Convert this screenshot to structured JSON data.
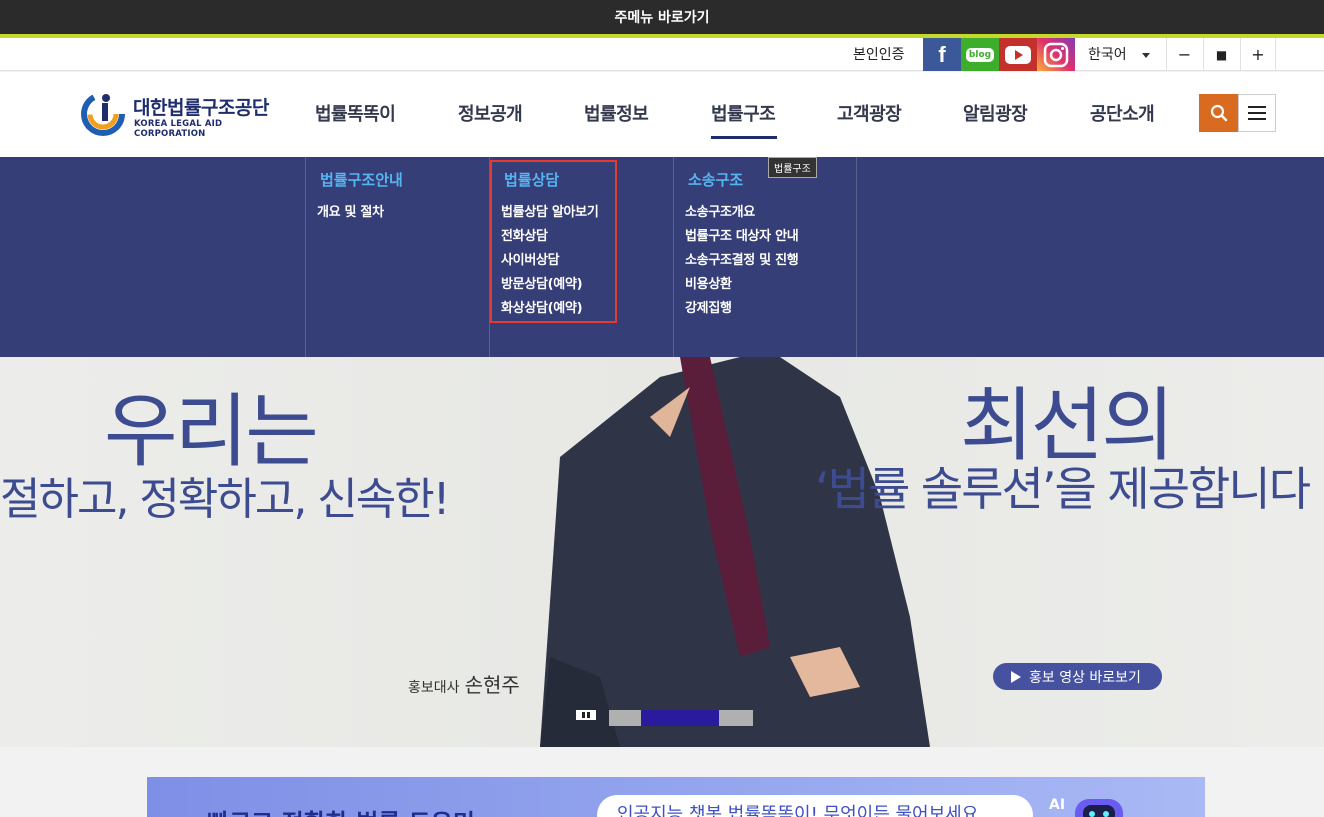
{
  "skip_link": "주메뉴 바로가기",
  "util": {
    "auth": "본인인증",
    "sns": {
      "facebook": "f",
      "blog": "blog"
    },
    "language": "한국어",
    "zoom_out": "−",
    "zoom_reset": "■",
    "zoom_in": "+"
  },
  "header": {
    "logo_ko": "대한법률구조공단",
    "logo_en": "KOREA LEGAL AID CORPORATION",
    "nav": [
      "법률똑똑이",
      "정보공개",
      "법률정보",
      "법률구조",
      "고객광장",
      "알림광장",
      "공단소개"
    ],
    "tooltip": "법률구조"
  },
  "megamenu": {
    "columns": [
      {
        "title": "법률구조안내",
        "items": [
          "개요 및 절차"
        ]
      },
      {
        "title": "법률상담",
        "items": [
          "법률상담 알아보기",
          "전화상담",
          "사이버상담",
          "방문상담(예약)",
          "화상상담(예약)"
        ]
      },
      {
        "title": "소송구조",
        "items": [
          "소송구조개요",
          "법률구조 대상자 안내",
          "소송구조결정 및 진행",
          "비용상환",
          "강제집행"
        ]
      }
    ]
  },
  "hero": {
    "left_line1": "우리는",
    "left_line2": "절하고, 정확하고, 신속한!",
    "right_line1": "최선의",
    "right_line2": "‘법률 솔루션’을 제공합니다",
    "ambassador_label": "홍보대사",
    "ambassador_name": "손현주",
    "video_button": "홍보 영상 바로보기",
    "progress": 0.54
  },
  "banner": {
    "text": "빠르고 정확한 법률 도우미",
    "input_placeholder": "인공지능 챗봇 법률똑똑이! 무엇이든 물어보세요.",
    "ai_label": "AI"
  },
  "colors": {
    "brand_navy": "#1f2d6e",
    "hero_text": "#3d4b90",
    "search_orange": "#d86b1f",
    "menu_link": "#56b4f0",
    "highlight_red": "#e53a2e"
  }
}
